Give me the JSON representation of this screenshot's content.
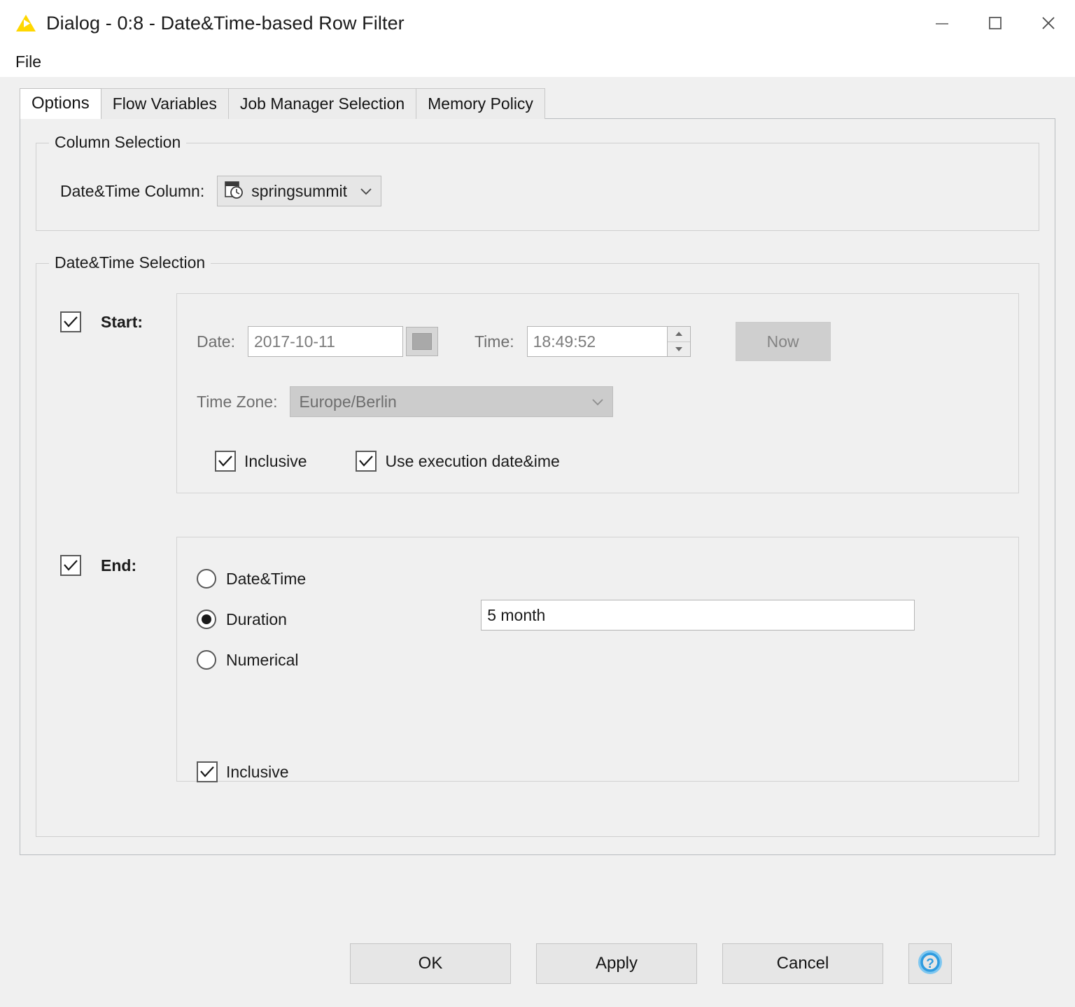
{
  "window": {
    "title": "Dialog - 0:8 - Date&Time-based Row Filter",
    "app_icon": "knime-triangle-icon",
    "controls": {
      "minimize": "minimize-icon",
      "maximize": "maximize-icon",
      "close": "close-icon"
    }
  },
  "menubar": {
    "items": [
      "File"
    ]
  },
  "tabs": [
    {
      "label": "Options",
      "active": true
    },
    {
      "label": "Flow Variables",
      "active": false
    },
    {
      "label": "Job Manager Selection",
      "active": false
    },
    {
      "label": "Memory Policy",
      "active": false
    }
  ],
  "column_selection": {
    "group_title": "Column Selection",
    "label": "Date&Time Column:",
    "combo": {
      "icon": "calendar-clock-icon",
      "value": "springsummit",
      "chevron": "chevron-down-icon"
    }
  },
  "datetime_selection": {
    "group_title": "Date&Time Selection",
    "start": {
      "enabled_label": "Start:",
      "enabled_checked": true,
      "date_label": "Date:",
      "date_value": "2017-10-11",
      "date_disabled": true,
      "calendar_button": "calendar-icon",
      "time_label": "Time:",
      "time_value": "18:49:52",
      "time_disabled": true,
      "spinner": "spinner-up-down",
      "now_button": "Now",
      "now_disabled": true,
      "timezone_label": "Time Zone:",
      "timezone_value": "Europe/Berlin",
      "timezone_disabled": true,
      "inclusive_label": "Inclusive",
      "inclusive_checked": true,
      "use_execution_label": "Use execution date&ime",
      "use_execution_checked": true
    },
    "end": {
      "enabled_label": "End:",
      "enabled_checked": true,
      "modes": [
        {
          "label": "Date&Time",
          "selected": false
        },
        {
          "label": "Duration",
          "selected": true
        },
        {
          "label": "Numerical",
          "selected": false
        }
      ],
      "duration_value": "5 month",
      "inclusive_label": "Inclusive",
      "inclusive_checked": true
    }
  },
  "footer": {
    "ok": "OK",
    "apply": "Apply",
    "cancel": "Cancel",
    "help": "help-icon"
  },
  "colors": {
    "window_background": "#f0f0f0",
    "titlebar_background": "#ffffff",
    "accent_logo": "#ffd700",
    "help_blue": "#2e9bdf",
    "disabled_text": "#7c7c7c"
  }
}
